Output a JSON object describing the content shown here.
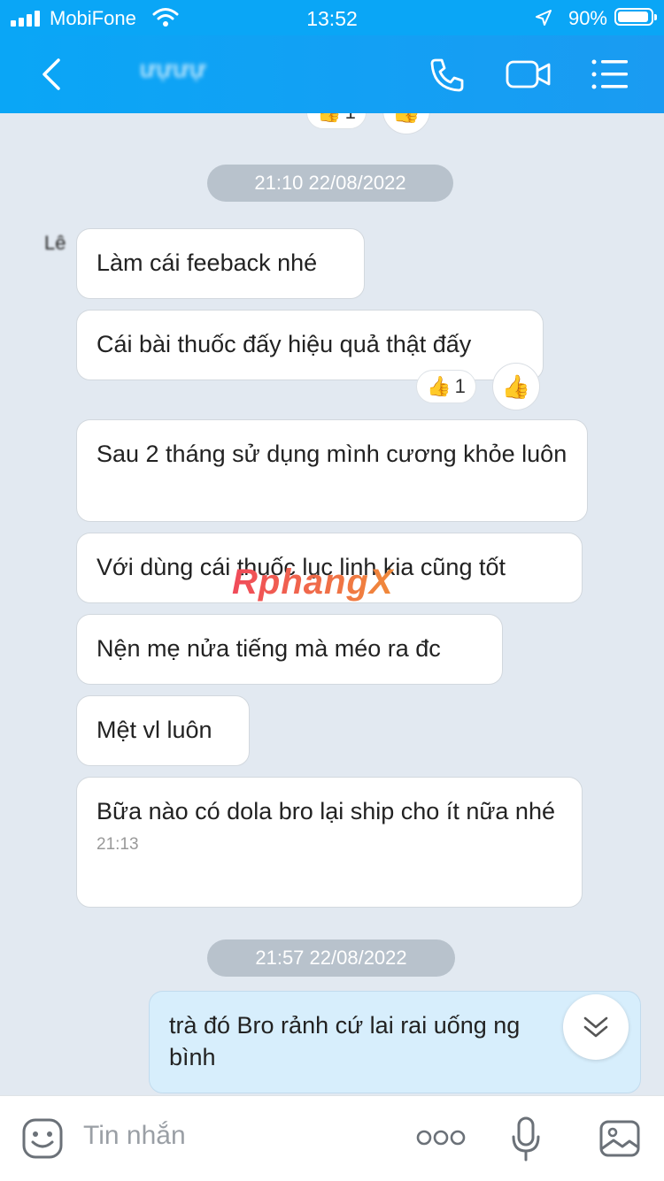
{
  "status": {
    "carrier": "MobiFone",
    "time": "13:52",
    "battery": "90%"
  },
  "header": {
    "title": "ưựưự"
  },
  "chat": {
    "top_reaction_count": "1",
    "watermark": "RphangX",
    "avatar_initial": "Lê",
    "dates": [
      "21:10 22/08/2022",
      "21:57 22/08/2022"
    ],
    "messages": [
      {
        "text": "Làm cái feeback nhé"
      },
      {
        "text": "Cái bài thuốc đấy hiệu quả thật đấy",
        "reaction_count": "1"
      },
      {
        "text": "Sau 2 tháng sử dụng mình cương khỏe luôn"
      },
      {
        "text": "Với dùng cái thuốc lục linh kia cũng tốt"
      },
      {
        "text": "Nện mẹ nửa tiếng mà méo ra đc"
      },
      {
        "text": "Mệt vl luôn"
      },
      {
        "text": "Bữa nào có dola bro lại ship cho ít nữa nhé",
        "time": "21:13"
      },
      {
        "text": "trà đó Bro rảnh cứ lai rai uống ng bình"
      }
    ]
  },
  "input": {
    "placeholder": "Tin nhắn"
  },
  "icons": [
    "signal-icon",
    "wifi-icon",
    "location-icon",
    "battery-icon",
    "back-icon",
    "phone-icon",
    "video-icon",
    "menu-icon",
    "thumbs-up-icon",
    "chevrons-down-icon",
    "emoji-icon",
    "more-icon",
    "mic-icon",
    "image-icon"
  ]
}
